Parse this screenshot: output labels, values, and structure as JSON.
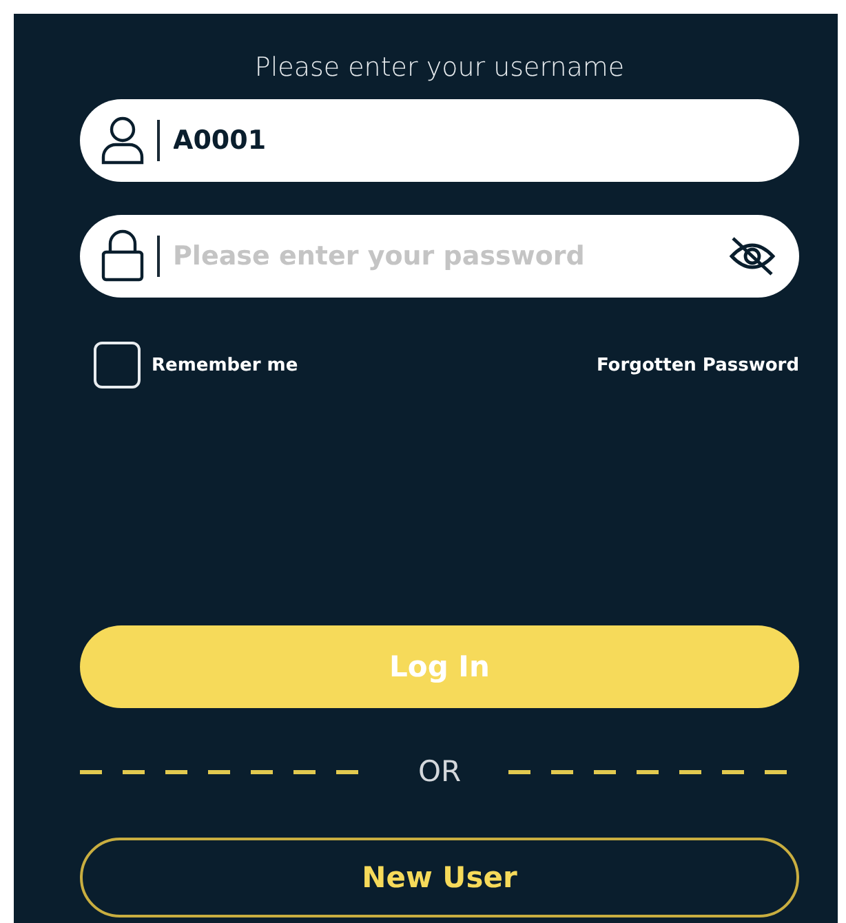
{
  "heading": "Please enter your username",
  "username": {
    "value": "A0001"
  },
  "password": {
    "placeholder": "Please enter your password",
    "visible": false
  },
  "remember": {
    "label": "Remember me",
    "checked": false
  },
  "forgot_link": "Forgotten Password",
  "login_button": "Log In",
  "divider": "OR",
  "new_user_button": "New User"
}
